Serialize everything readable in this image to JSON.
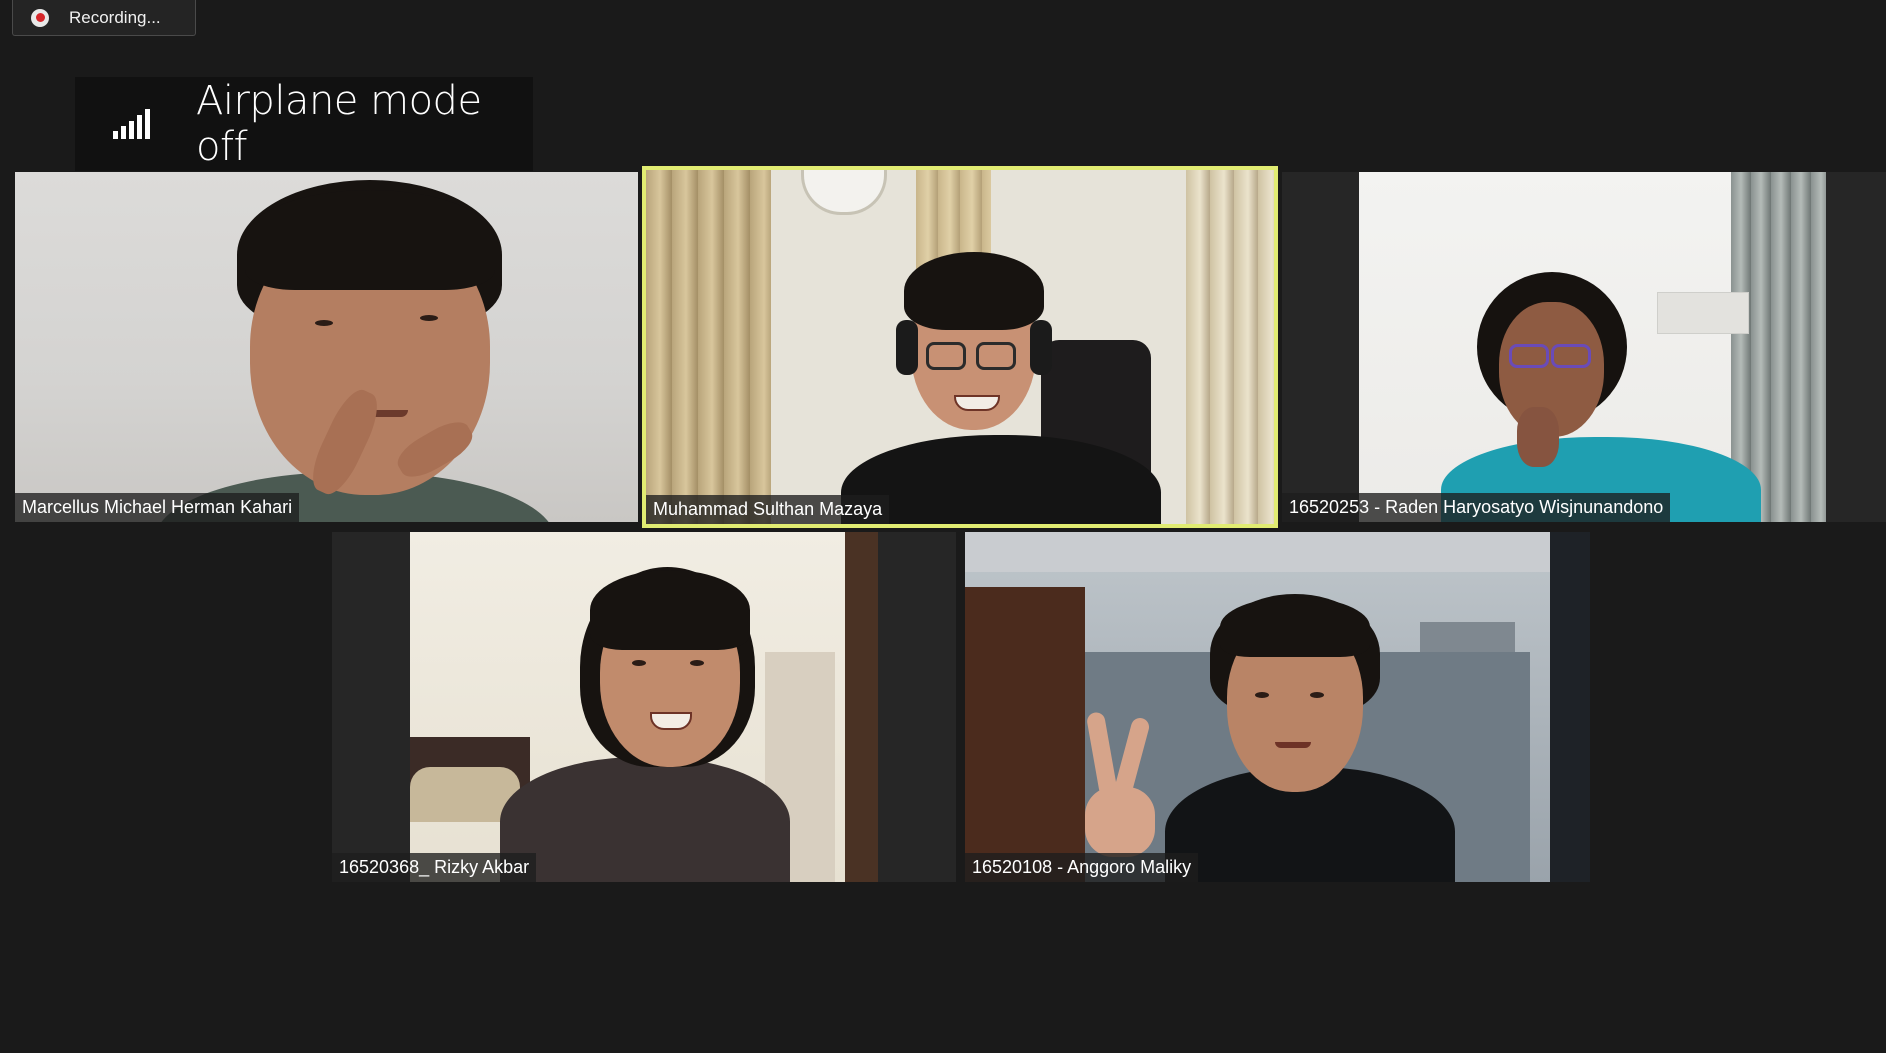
{
  "recording": {
    "label": "Recording...",
    "icon": "record-icon"
  },
  "toast": {
    "text": "Airplane mode off",
    "icon": "signal-bars-icon"
  },
  "colors": {
    "background": "#1a1a1a",
    "active_speaker_border": "#e1ec72",
    "recording_dot": "#d6262a"
  },
  "participants": [
    {
      "name": "Marcellus Michael Herman Kahari",
      "active": false
    },
    {
      "name": "Muhammad Sulthan Mazaya",
      "active": true
    },
    {
      "name": "16520253 - Raden Haryosatyo Wisjnunandono",
      "active": false
    },
    {
      "name": "16520368_ Rizky Akbar",
      "active": false
    },
    {
      "name": "16520108 - Anggoro Maliky",
      "active": false
    }
  ]
}
